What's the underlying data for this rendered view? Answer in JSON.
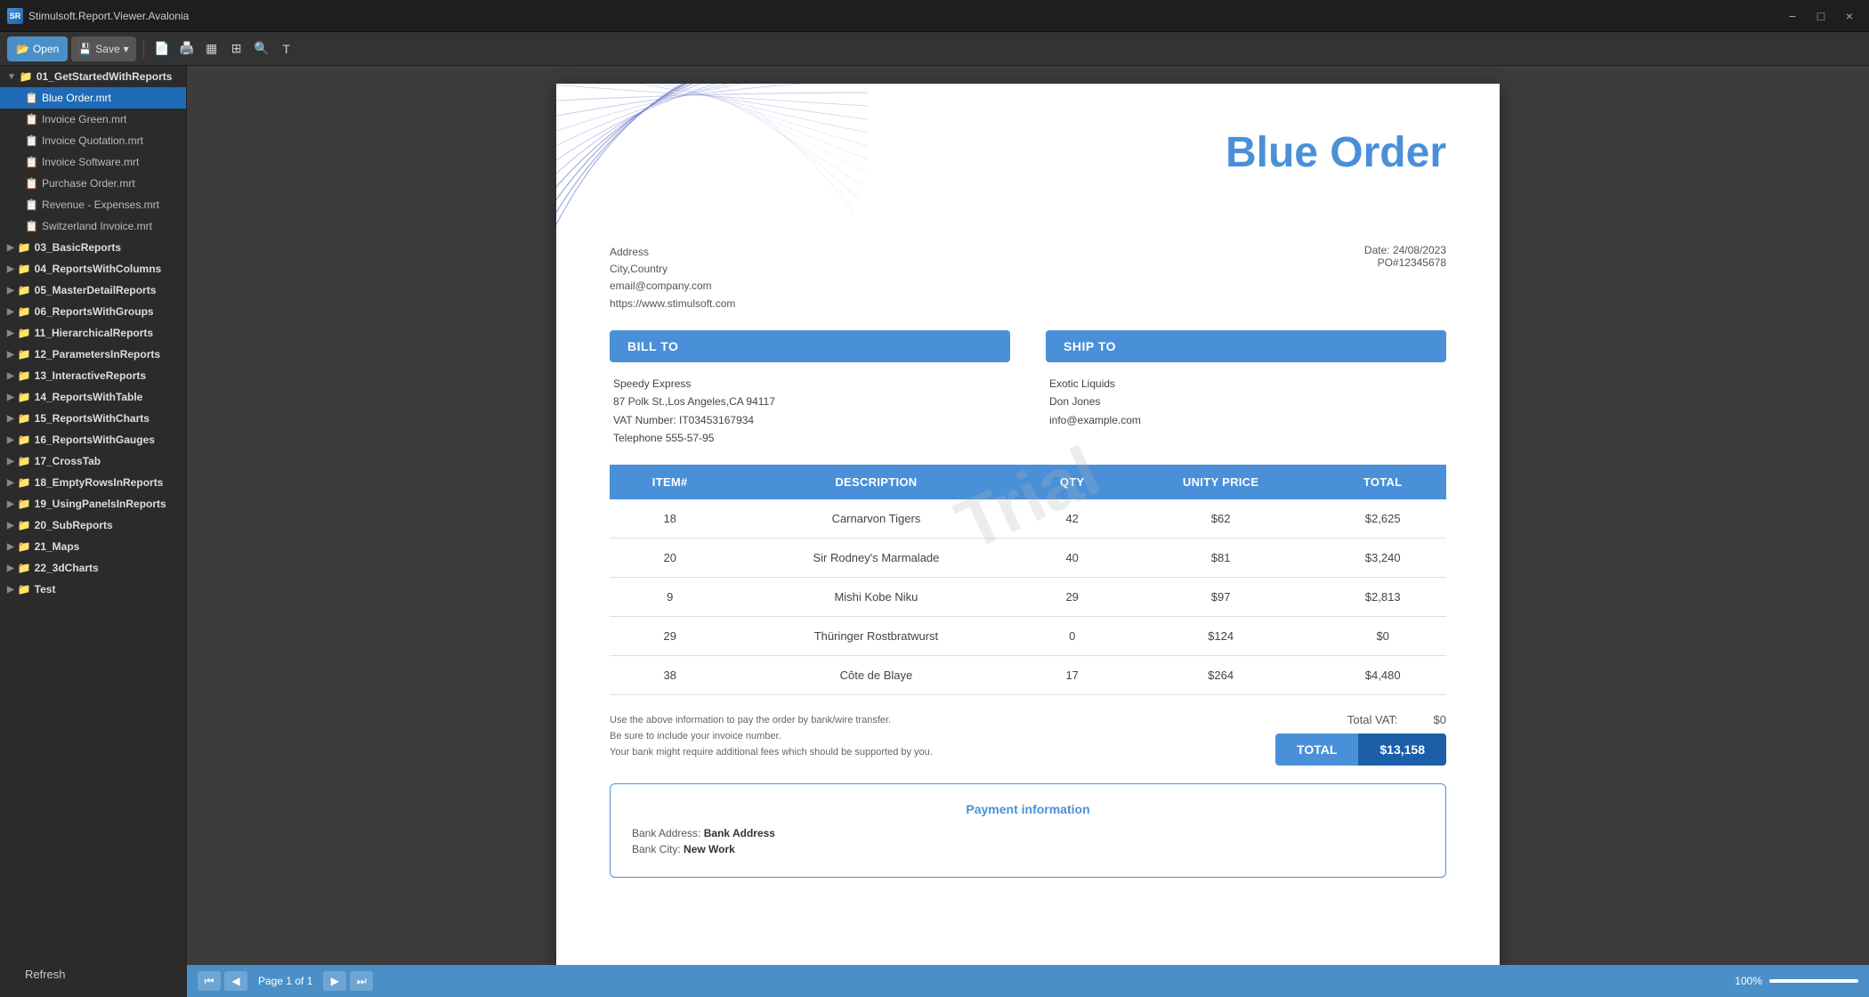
{
  "titleBar": {
    "appName": "Stimulsoft.Report.Viewer.Avalonia",
    "iconLabel": "SR",
    "minimizeLabel": "−",
    "maximizeLabel": "□",
    "closeLabel": "×"
  },
  "toolbar": {
    "openLabel": "Open",
    "saveLabel": "Save",
    "saveDropdown": "▾"
  },
  "sidebar": {
    "folders": [
      {
        "id": "01_GetStartedWithReports",
        "label": "01_GetStartedWithReports",
        "expanded": true,
        "files": [
          {
            "name": "Blue Order.mrt",
            "active": true
          },
          {
            "name": "Invoice Green.mrt",
            "active": false
          },
          {
            "name": "Invoice Quotation.mrt",
            "active": false
          },
          {
            "name": "Invoice Software.mrt",
            "active": false
          },
          {
            "name": "Purchase Order.mrt",
            "active": false
          },
          {
            "name": "Revenue - Expenses.mrt",
            "active": false
          },
          {
            "name": "Switzerland Invoice.mrt",
            "active": false
          }
        ]
      },
      {
        "id": "03_BasicReports",
        "label": "03_BasicReports",
        "expanded": false
      },
      {
        "id": "04_ReportsWithColumns",
        "label": "04_ReportsWithColumns",
        "expanded": false
      },
      {
        "id": "05_MasterDetailReports",
        "label": "05_MasterDetailReports",
        "expanded": false
      },
      {
        "id": "06_ReportsWithGroups",
        "label": "06_ReportsWithGroups",
        "expanded": false
      },
      {
        "id": "11_HierarchicalReports",
        "label": "11_HierarchicalReports",
        "expanded": false
      },
      {
        "id": "12_ParametersInReports",
        "label": "12_ParametersInReports",
        "expanded": false
      },
      {
        "id": "13_InteractiveReports",
        "label": "13_InteractiveReports",
        "expanded": false
      },
      {
        "id": "14_ReportsWithTable",
        "label": "14_ReportsWithTable",
        "expanded": false
      },
      {
        "id": "15_ReportsWithCharts",
        "label": "15_ReportsWithCharts",
        "expanded": false
      },
      {
        "id": "16_ReportsWithGauges",
        "label": "16_ReportsWithGauges",
        "expanded": false
      },
      {
        "id": "17_CrossTab",
        "label": "17_CrossTab",
        "expanded": false
      },
      {
        "id": "18_EmptyRowsInReports",
        "label": "18_EmptyRowsInReports",
        "expanded": false
      },
      {
        "id": "19_UsingPanelsInReports",
        "label": "19_UsingPanelsInReports",
        "expanded": false
      },
      {
        "id": "20_SubReports",
        "label": "20_SubReports",
        "expanded": false
      },
      {
        "id": "21_Maps",
        "label": "21_Maps",
        "expanded": false
      },
      {
        "id": "22_3dCharts",
        "label": "22_3dCharts",
        "expanded": false
      },
      {
        "id": "Test",
        "label": "Test",
        "expanded": false
      }
    ]
  },
  "report": {
    "title": "Blue Order",
    "address": {
      "line1": "Address",
      "line2": "City,Country",
      "line3": "email@company.com",
      "line4": "https://www.stimulsoft.com"
    },
    "meta": {
      "date": "Date: 24/08/2023",
      "po": "PO#12345678"
    },
    "billTo": {
      "label": "BILL TO",
      "company": "Speedy Express",
      "address": "87 Polk St.,Los Angeles,CA 94117",
      "vat": "VAT Number: IT03453167934",
      "telephone": "Telephone 555-57-95"
    },
    "shipTo": {
      "label": "SHIP TO",
      "company": "Exotic Liquids",
      "contact": "Don Jones",
      "email": "info@example.com"
    },
    "table": {
      "headers": [
        "ITEM#",
        "DESCRIPTION",
        "QTY",
        "UNITY PRICE",
        "TOTAL"
      ],
      "rows": [
        {
          "item": "18",
          "description": "Carnarvon Tigers",
          "qty": "42",
          "price": "$62",
          "total": "$2,625"
        },
        {
          "item": "20",
          "description": "Sir Rodney's Marmalade",
          "qty": "40",
          "price": "$81",
          "total": "$3,240"
        },
        {
          "item": "9",
          "description": "Mishi Kobe Niku",
          "qty": "29",
          "price": "$97",
          "total": "$2,813"
        },
        {
          "item": "29",
          "description": "Thüringer Rostbratwurst",
          "qty": "0",
          "price": "$124",
          "total": "$0"
        },
        {
          "item": "38",
          "description": "Côte de Blaye",
          "qty": "17",
          "price": "$264",
          "total": "$4,480"
        }
      ]
    },
    "watermark": "Trial",
    "footer": {
      "note": "Use the above information to pay the order by bank/wire transfer.\nBe sure to include your invoice number.\nYour bank might require additional fees which should be supported by you.",
      "vatLabel": "Total VAT:",
      "vatValue": "$0",
      "totalLabel": "TOTAL",
      "totalValue": "$13,158"
    },
    "payment": {
      "title": "Payment information",
      "bankAddress": "Bank Address",
      "bankAddressLabel": "Bank Address:",
      "bankCity": "New Work",
      "bankCityLabel": "Bank City:"
    }
  },
  "bottomBar": {
    "pageInfo": "Page 1 of 1",
    "zoomLabel": "100%"
  },
  "refreshLabel": "Refresh",
  "colors": {
    "accent": "#4a90d9",
    "accentDark": "#1a5fa8",
    "sidebar": "#2b2b2b",
    "toolbar": "#333"
  }
}
